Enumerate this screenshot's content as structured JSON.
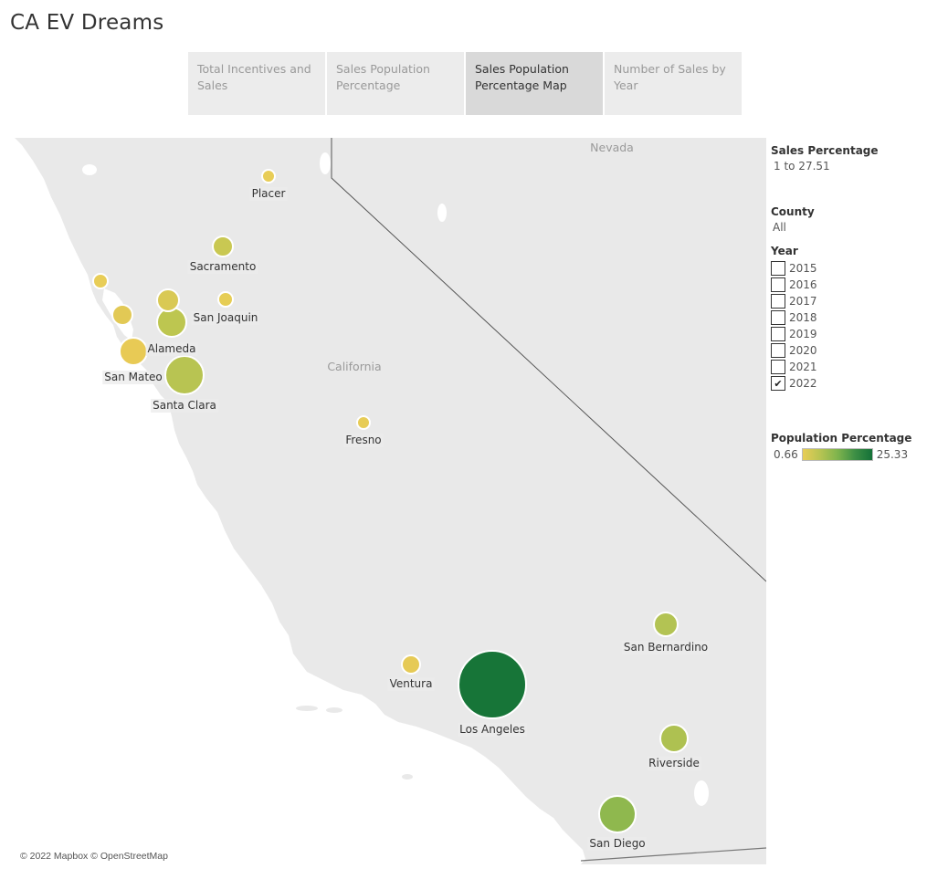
{
  "dashboard": {
    "title": "CA EV Dreams"
  },
  "tabs": [
    {
      "label": "Total Incentives and Sales",
      "active": false
    },
    {
      "label": "Sales Population Percentage",
      "active": false
    },
    {
      "label": "Sales Population Percentage Map",
      "active": true
    },
    {
      "label": "Number of Sales by Year",
      "active": false
    }
  ],
  "map": {
    "region_labels": {
      "state": "California",
      "neighbor": "Nevada"
    },
    "attribution": "© 2022 Mapbox © OpenStreetMap",
    "counties": [
      {
        "name": "Placer",
        "color": "#e8cd57"
      },
      {
        "name": "Sacramento",
        "color": "#c9c852"
      },
      {
        "name": "San Joaquin",
        "color": "#e6cd55"
      },
      {
        "name": "Alameda",
        "color": "#bdc650"
      },
      {
        "name": "San Mateo",
        "color": "#e8ca55"
      },
      {
        "name": "Santa Clara",
        "color": "#b8c452"
      },
      {
        "name": "Fresno",
        "color": "#e7cc56"
      },
      {
        "name": "Ventura",
        "color": "#e6ca56"
      },
      {
        "name": "Los Angeles",
        "color": "#177538"
      },
      {
        "name": "San Bernardino",
        "color": "#b3c353"
      },
      {
        "name": "Riverside",
        "color": "#aec151"
      },
      {
        "name": "San Diego",
        "color": "#8fb84e"
      },
      {
        "name": "",
        "color": "#e8cd57"
      },
      {
        "name": "",
        "color": "#e2c955"
      },
      {
        "name": "",
        "color": "#d9c954"
      }
    ]
  },
  "filters": {
    "sales_percentage": {
      "title": "Sales Percentage",
      "value": "1 to 27.51"
    },
    "county": {
      "title": "County",
      "value": "All"
    },
    "year": {
      "title": "Year",
      "options": [
        {
          "label": "2015",
          "checked": false
        },
        {
          "label": "2016",
          "checked": false
        },
        {
          "label": "2017",
          "checked": false
        },
        {
          "label": "2018",
          "checked": false
        },
        {
          "label": "2019",
          "checked": false
        },
        {
          "label": "2020",
          "checked": false
        },
        {
          "label": "2021",
          "checked": false
        },
        {
          "label": "2022",
          "checked": true
        }
      ]
    }
  },
  "legend": {
    "title": "Population Percentage",
    "min": "0.66",
    "max": "25.33",
    "color_low": "#e8cd57",
    "color_high": "#147138"
  }
}
